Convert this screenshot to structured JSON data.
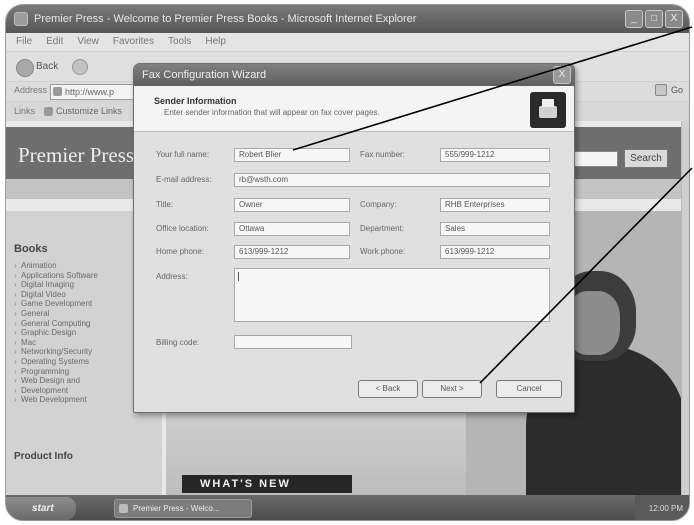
{
  "browser": {
    "title": "Premier Press - Welcome to Premier Press Books - Microsoft Internet Explorer",
    "menu": [
      "File",
      "Edit",
      "View",
      "Favorites",
      "Tools",
      "Help"
    ],
    "back_label": "Back",
    "address_label": "Address",
    "address_value": "http://www.p",
    "go_label": "Go",
    "links_label": "Links",
    "links_item": "Customize Links",
    "window_buttons": [
      "_",
      "□",
      "X"
    ]
  },
  "webpage": {
    "banner_title": "Premier Press",
    "search_label": "Search",
    "sidebar_heading": "Books",
    "sidebar_items": [
      "Animation",
      "Applications Software",
      "Digital Imaging",
      "Digital Video",
      "Game Development",
      "General",
      "General Computing",
      "Graphic Design",
      "Mac",
      "Networking/Security",
      "Operating Systems",
      "Programming",
      "Web Design and",
      "Development",
      "Web Development"
    ],
    "sidebar_footer": "Product Info",
    "whats_new": "WHAT'S NEW"
  },
  "taskbar": {
    "start_label": "start",
    "task_item": "Premier Press - Welco...",
    "tray_text": "12:00 PM"
  },
  "dialog": {
    "title": "Fax Configuration Wizard",
    "close_symbol": "X",
    "heading": "Sender Information",
    "subheading": "Enter sender information that will appear on fax cover pages.",
    "fields": {
      "full_name_label": "Your full name:",
      "full_name_value": "Robert Blier",
      "fax_number_label": "Fax number:",
      "fax_number_value": "555/999-1212",
      "email_label": "E-mail address:",
      "email_value": "rb@wsth.com",
      "title_label": "Title:",
      "title_value": "Owner",
      "company_label": "Company:",
      "company_value": "RHB Enterprises",
      "office_label": "Office location:",
      "office_value": "Ottawa",
      "department_label": "Department:",
      "department_value": "Sales",
      "home_phone_label": "Home phone:",
      "home_phone_value": "613/999-1212",
      "work_phone_label": "Work phone:",
      "work_phone_value": "613/999-1212",
      "address_label": "Address:",
      "address_value": "",
      "billing_label": "Billing code:",
      "billing_value": ""
    },
    "buttons": {
      "back": "< Back",
      "next": "Next >",
      "cancel": "Cancel"
    }
  },
  "colors": {
    "dialog_title_bar": "#6e6e6e",
    "banner": "#6e6e6e",
    "callout_line": "#000000"
  }
}
